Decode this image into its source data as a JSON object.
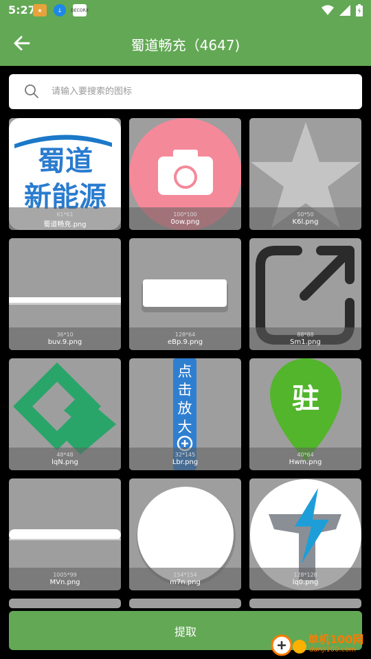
{
  "status_bar": {
    "time": "5:27",
    "apps": [
      "app-store-icon",
      "download-icon",
      "browser-icon"
    ],
    "app_labels": [
      "",
      "",
      "DECORX"
    ]
  },
  "header": {
    "title": "蜀道畅充（4647)"
  },
  "search": {
    "placeholder": "请输入要搜索的图标",
    "value": ""
  },
  "icons": [
    {
      "size": "61*61",
      "name": "蜀道畅充.png",
      "art": "logo"
    },
    {
      "size": "100*100",
      "name": "0ow.png",
      "art": "camera"
    },
    {
      "size": "50*50",
      "name": "K6l.png",
      "art": "star"
    },
    {
      "size": "36*10",
      "name": "buv.9.png",
      "art": "line"
    },
    {
      "size": "128*64",
      "name": "eBp.9.png",
      "art": "card"
    },
    {
      "size": "88*88",
      "name": "Sm1.png",
      "art": "share"
    },
    {
      "size": "48*48",
      "name": "lqN.png",
      "art": "diamond"
    },
    {
      "size": "32*145",
      "name": "Lbr.png",
      "art": "zoom"
    },
    {
      "size": "40*64",
      "name": "Hwm.png",
      "art": "pin"
    },
    {
      "size": "1005*99",
      "name": "MVn.png",
      "art": "bar"
    },
    {
      "size": "154*154",
      "name": "m7n.png",
      "art": "circle"
    },
    {
      "size": "128*128",
      "name": "lq0.png",
      "art": "bolt"
    }
  ],
  "art_text": {
    "logo_top": "蜀道",
    "logo_bottom": "新能源",
    "zoom_text": "点击放大",
    "pin_text": "驻"
  },
  "extract_button": {
    "label": "提取"
  },
  "watermark": {
    "text": "单机100网",
    "url": "danji100.com"
  },
  "colors": {
    "accent": "#63a855",
    "tile_bg": "#9e9e9e"
  }
}
